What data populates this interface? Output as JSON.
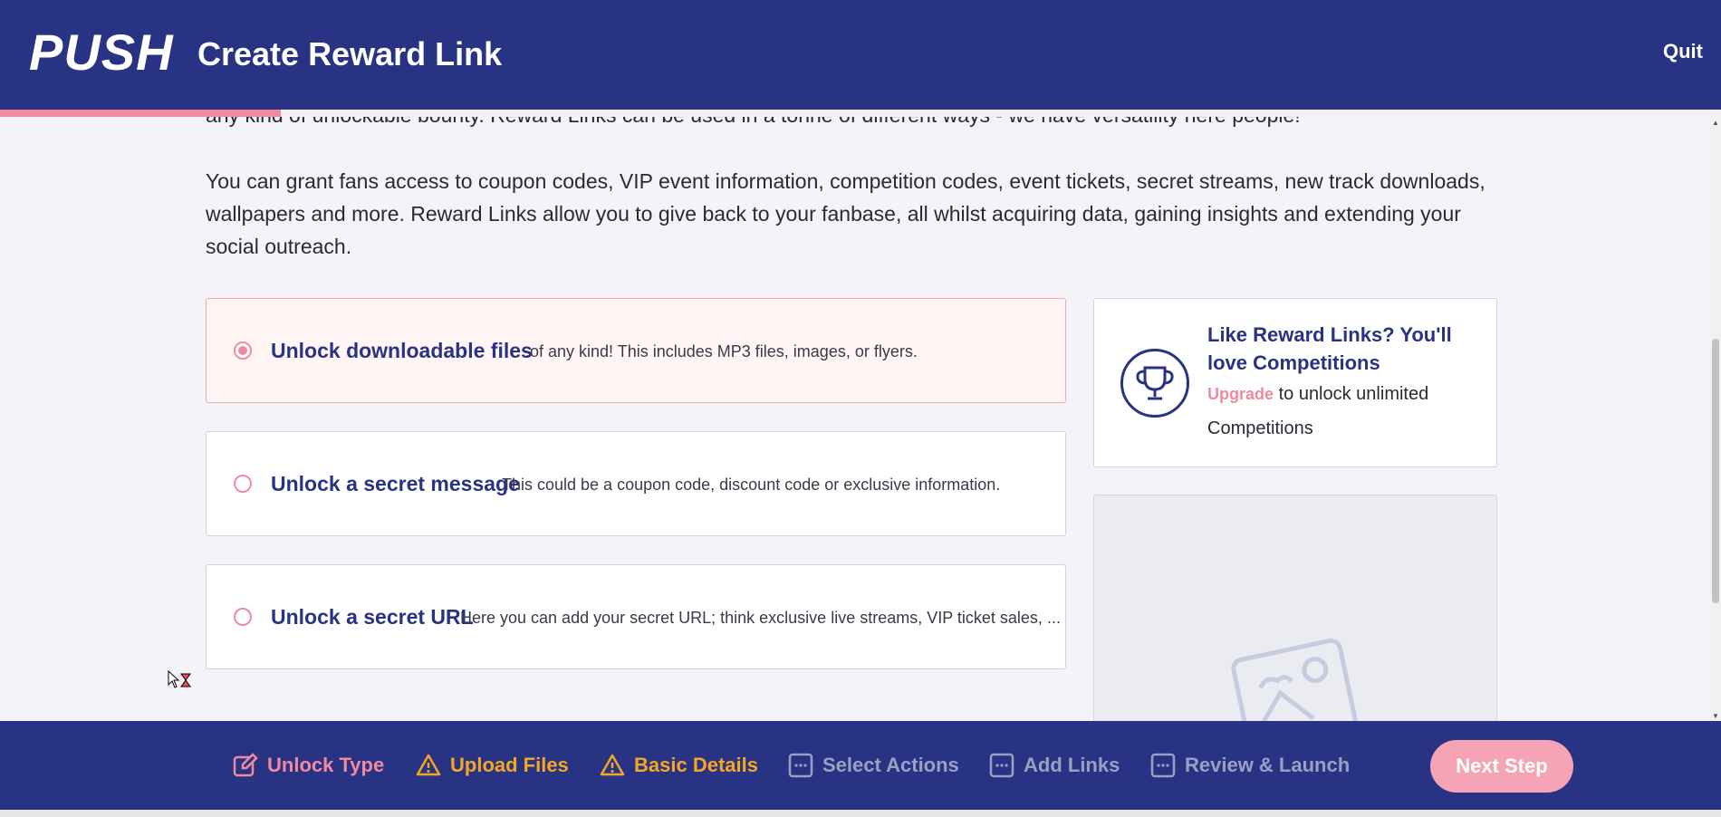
{
  "header": {
    "logo": "PUSH",
    "title": "Create Reward Link",
    "quit_label": "Quit",
    "progress": 0.163
  },
  "intro": {
    "cut_line": "any kind of unlockable bounty. Reward Links can be used in a tonne of different ways - we have versatility here people!",
    "paragraph": "You can grant fans access to coupon codes, VIP event information, competition codes, event tickets, secret streams, new track downloads, wallpapers and more. Reward Links allow you to give back to your fanbase, all whilst acquiring data, gaining insights and extending your social outreach."
  },
  "options": [
    {
      "title": "Unlock downloadable files",
      "description": "...of any kind! This includes MP3 files, images, or flyers.",
      "selected": true
    },
    {
      "title": "Unlock a secret message",
      "description": "This could be a coupon code, discount code or exclusive information.",
      "selected": false
    },
    {
      "title": "Unlock a secret URL",
      "description": "Here you can add your secret URL; think exclusive live streams, VIP ticket sales, ...",
      "selected": false
    }
  ],
  "promo": {
    "title": "Like Reward Links? You'll love Competitions",
    "upgrade_link": "Upgrade",
    "text": "to unlock unlimited Competitions",
    "icon": "trophy-icon"
  },
  "footer": {
    "steps": [
      {
        "label": "Unlock Type",
        "state": "active",
        "icon": "edit-icon"
      },
      {
        "label": "Upload Files",
        "state": "warning",
        "icon": "warning-icon"
      },
      {
        "label": "Basic Details",
        "state": "warning",
        "icon": "warning-icon"
      },
      {
        "label": "Select Actions",
        "state": "todo",
        "icon": "dots-box-icon"
      },
      {
        "label": "Add Links",
        "state": "todo",
        "icon": "dots-box-icon"
      },
      {
        "label": "Review & Launch",
        "state": "todo",
        "icon": "dots-box-icon"
      }
    ],
    "next_label": "Next Step"
  },
  "colors": {
    "brand_navy": "#283383",
    "accent_pink": "#ef8aa0",
    "warning_orange": "#f5a623",
    "muted": "#9aa0c4"
  }
}
